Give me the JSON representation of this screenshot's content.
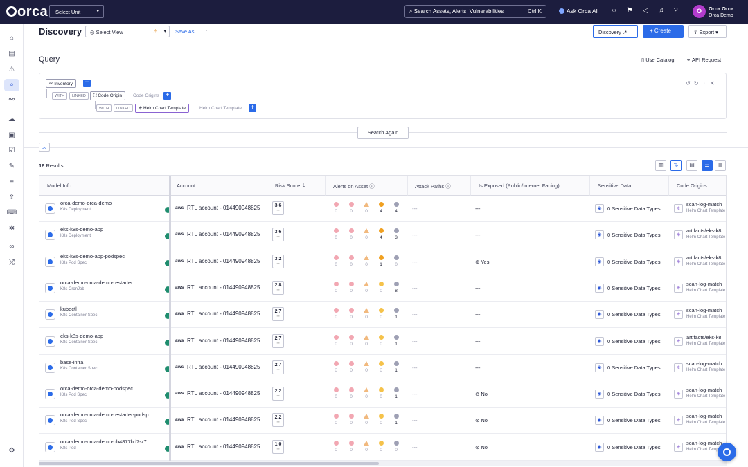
{
  "topbar": {
    "logo": "orca",
    "select_unit": "Select Unit",
    "search_placeholder": "Search Assets, Alerts, Vulnerabilities",
    "search_shortcut": "Ctrl K",
    "ask_ai": "Ask Orca AI",
    "user_initial": "O",
    "user_name": "Orca Orca",
    "user_org": "Orca Demo"
  },
  "header": {
    "title": "Discovery",
    "select_view": "Select View",
    "save_as": "Save As",
    "discovery_btn": "Discovery",
    "create_btn": "Create",
    "export_btn": "Export"
  },
  "query": {
    "title": "Query",
    "use_catalog": "Use Catalog",
    "api_request": "API Request",
    "root": "Inventory",
    "with": "WITH",
    "linked": "LINKED",
    "level1": "Code Origin",
    "level1_hint": "Code Origins",
    "level2": "Helm Chart Template",
    "level2_hint": "Helm Chart Template",
    "search_again": "Search Again"
  },
  "results": {
    "count": "16",
    "label": "Results"
  },
  "columns": [
    "Model Info",
    "Account",
    "Risk Score",
    "Alerts on Asset",
    "Attack Paths",
    "Is Exposed (Public/Internet Facing)",
    "Sensitive Data",
    "Code Origins"
  ],
  "rows": [
    {
      "name": "orca-demo-orca-demo",
      "type": "K8s Deployment",
      "account": "RTL account - 014490948825",
      "risk": "3.6",
      "alerts": [
        "0",
        "0",
        "0",
        "4",
        "4"
      ],
      "paths": "---",
      "exposed": "---",
      "sensitive": "0 Sensitive Data Types",
      "origin": "scan-log-match",
      "origin_sub": "Helm Chart Template"
    },
    {
      "name": "eks-k8s-demo-app",
      "type": "K8s Deployment",
      "account": "RTL account - 014490948825",
      "risk": "3.6",
      "alerts": [
        "0",
        "0",
        "0",
        "4",
        "3"
      ],
      "paths": "---",
      "exposed": "---",
      "sensitive": "0 Sensitive Data Types",
      "origin": "artifacts/eks-k8",
      "origin_sub": "Helm Chart Template"
    },
    {
      "name": "eks-k8s-demo-app-podspec",
      "type": "K8s Pod Spec",
      "account": "RTL account - 014490948825",
      "risk": "3.2",
      "alerts": [
        "0",
        "0",
        "0",
        "1",
        "0"
      ],
      "paths": "---",
      "exposed": "Yes",
      "sensitive": "0 Sensitive Data Types",
      "origin": "artifacts/eks-k8",
      "origin_sub": "Helm Chart Template"
    },
    {
      "name": "orca-demo-orca-demo-restarter",
      "type": "K8s CronJob",
      "account": "RTL account - 014490948825",
      "risk": "2.8",
      "alerts": [
        "0",
        "0",
        "0",
        "0",
        "8"
      ],
      "paths": "---",
      "exposed": "---",
      "sensitive": "0 Sensitive Data Types",
      "origin": "scan-log-match",
      "origin_sub": "Helm Chart Template"
    },
    {
      "name": "kubectl",
      "type": "K8s Container Spec",
      "account": "RTL account - 014490948825",
      "risk": "2.7",
      "alerts": [
        "0",
        "0",
        "0",
        "0",
        "1"
      ],
      "paths": "---",
      "exposed": "---",
      "sensitive": "0 Sensitive Data Types",
      "origin": "scan-log-match",
      "origin_sub": "Helm Chart Template"
    },
    {
      "name": "eks-k8s-demo-app",
      "type": "K8s Container Spec",
      "account": "RTL account - 014490948825",
      "risk": "2.7",
      "alerts": [
        "0",
        "0",
        "0",
        "0",
        "1"
      ],
      "paths": "---",
      "exposed": "---",
      "sensitive": "0 Sensitive Data Types",
      "origin": "artifacts/eks-k8",
      "origin_sub": "Helm Chart Template"
    },
    {
      "name": "base-infra",
      "type": "K8s Container Spec",
      "account": "RTL account - 014490948825",
      "risk": "2.7",
      "alerts": [
        "0",
        "0",
        "0",
        "0",
        "1"
      ],
      "paths": "---",
      "exposed": "---",
      "sensitive": "0 Sensitive Data Types",
      "origin": "scan-log-match",
      "origin_sub": "Helm Chart Template"
    },
    {
      "name": "orca-demo-orca-demo-podspec",
      "type": "K8s Pod Spec",
      "account": "RTL account - 014490948825",
      "risk": "2.2",
      "alerts": [
        "0",
        "0",
        "0",
        "0",
        "1"
      ],
      "paths": "---",
      "exposed": "No",
      "sensitive": "0 Sensitive Data Types",
      "origin": "scan-log-match",
      "origin_sub": "Helm Chart Template"
    },
    {
      "name": "orca-demo-orca-demo-restarter-podsp...",
      "type": "K8s Pod Spec",
      "account": "RTL account - 014490948825",
      "risk": "2.2",
      "alerts": [
        "0",
        "0",
        "0",
        "0",
        "1"
      ],
      "paths": "---",
      "exposed": "No",
      "sensitive": "0 Sensitive Data Types",
      "origin": "scan-log-match",
      "origin_sub": "Helm Chart Template"
    },
    {
      "name": "orca-demo-orca-demo-bb4877bd7-z7...",
      "type": "K8s Pod",
      "account": "RTL account - 014490948825",
      "risk": "1.0",
      "alerts": [
        "0",
        "0",
        "0",
        "0",
        "0"
      ],
      "paths": "---",
      "exposed": "No",
      "sensitive": "0 Sensitive Data Types",
      "origin": "scan-log-match",
      "origin_sub": "Helm Chart Template"
    }
  ],
  "colors": {
    "brand": "#1c1d3e",
    "accent": "#2b6be8"
  }
}
